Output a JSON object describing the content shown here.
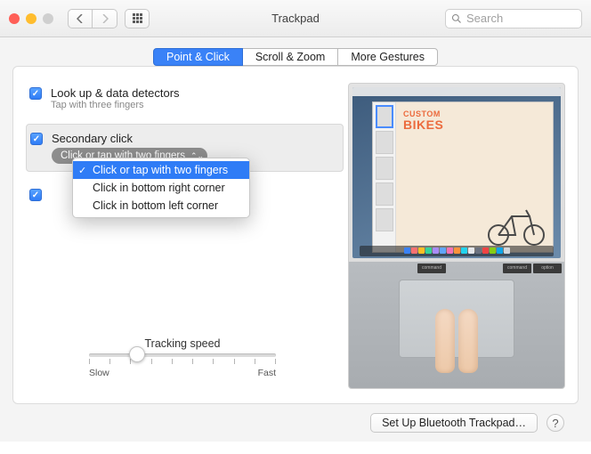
{
  "window": {
    "title": "Trackpad"
  },
  "toolbar": {
    "search_placeholder": "Search"
  },
  "tabs": [
    "Point & Click",
    "Scroll & Zoom",
    "More Gestures"
  ],
  "tab_selected": 0,
  "options": {
    "lookup": {
      "title": "Look up & data detectors",
      "sub": "Tap with three fingers",
      "checked": true
    },
    "secondary": {
      "title": "Secondary click",
      "checked": true,
      "combo_label": "Click or tap with two fingers",
      "menu": [
        "Click or tap with two fingers",
        "Click in bottom right corner",
        "Click in bottom left corner"
      ],
      "menu_selected": 0
    },
    "third": {
      "checked": true
    }
  },
  "speed": {
    "label": "Tracking speed",
    "min_label": "Slow",
    "max_label": "Fast",
    "ticks": 10,
    "value": 2
  },
  "preview": {
    "doc_line1": "CUSTOM",
    "doc_line2": "BIKES",
    "key_labels": [
      "command",
      "command",
      "option"
    ]
  },
  "footer": {
    "button": "Set Up Bluetooth Trackpad…"
  },
  "icons": {
    "back": "back-chevron-icon",
    "forward": "forward-chevron-icon",
    "grid": "grid-icon",
    "search": "search-icon",
    "help": "help-icon"
  }
}
